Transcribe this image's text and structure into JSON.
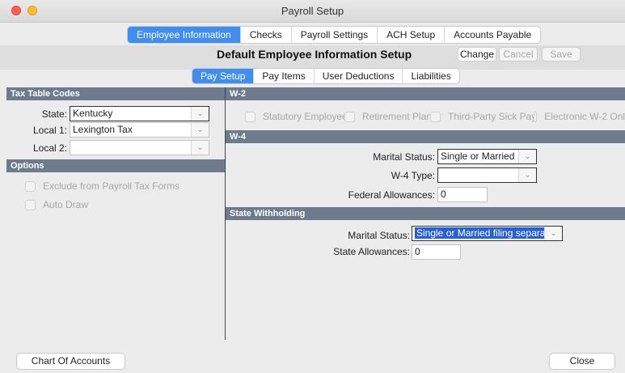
{
  "window": {
    "title": "Payroll Setup"
  },
  "top_tabs": [
    {
      "label": "Employee Information",
      "active": true
    },
    {
      "label": "Checks",
      "active": false
    },
    {
      "label": "Payroll Settings",
      "active": false
    },
    {
      "label": "ACH Setup",
      "active": false
    },
    {
      "label": "Accounts Payable",
      "active": false
    }
  ],
  "header": {
    "title": "Default Employee Information Setup",
    "change_label": "Change",
    "cancel_label": "Cancel",
    "save_label": "Save"
  },
  "sub_tabs": [
    {
      "label": "Pay Setup",
      "active": true
    },
    {
      "label": "Pay Items",
      "active": false
    },
    {
      "label": "User Deductions",
      "active": false
    },
    {
      "label": "Liabilities",
      "active": false
    }
  ],
  "tax_table": {
    "heading": "Tax Table Codes",
    "state_label": "State:",
    "state_value": "Kentucky",
    "local1_label": "Local 1:",
    "local1_value": "Lexington Tax",
    "local2_label": "Local 2:",
    "local2_value": ""
  },
  "options": {
    "heading": "Options",
    "exclude_label": "Exclude from Payroll Tax Forms",
    "auto_draw_label": "Auto Draw"
  },
  "w2": {
    "heading": "W-2",
    "statutory_label": "Statutory Employee",
    "retirement_label": "Retirement Plan",
    "sick_pay_label": "Third-Party Sick Pay",
    "electronic_label": "Electronic W-2 Onl"
  },
  "w4": {
    "heading": "W-4",
    "marital_label": "Marital Status:",
    "marital_value": "Single or Married ...",
    "type_label": "W-4 Type:",
    "type_value": "",
    "allowances_label": "Federal Allowances:",
    "allowances_value": "0"
  },
  "state_withholding": {
    "heading": "State Withholding",
    "marital_label": "Marital Status:",
    "marital_value": "Single or Married filing separat...",
    "allowances_label": "State Allowances:",
    "allowances_value": "0"
  },
  "footer": {
    "chart_label": "Chart Of Accounts",
    "close_label": "Close"
  }
}
